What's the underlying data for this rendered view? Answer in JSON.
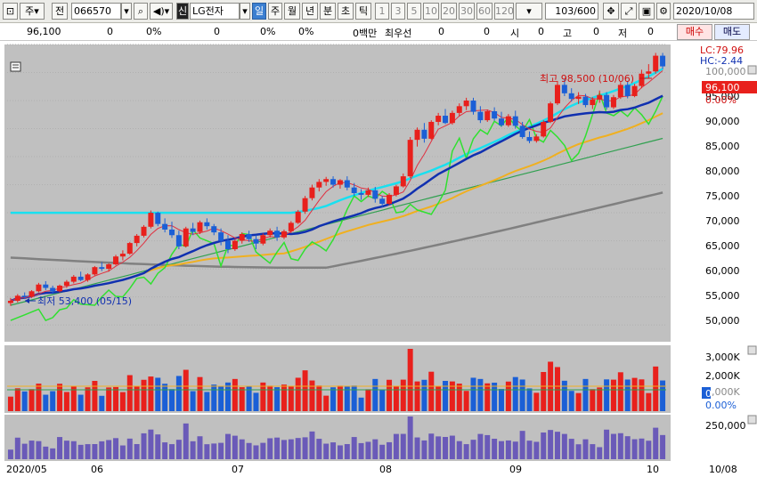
{
  "toolbar": {
    "period_label": "주",
    "prev_label": "전",
    "stock_code": "066570",
    "type_badge": "신",
    "stock_name": "LG전자",
    "timeframes": [
      "일",
      "주",
      "월",
      "년",
      "분",
      "초",
      "틱"
    ],
    "active_timeframe": "일",
    "intervals": [
      "1",
      "3",
      "5",
      "10",
      "20",
      "30",
      "60",
      "120"
    ],
    "count_display": "103/600",
    "date_value": "2020/10/08"
  },
  "info": {
    "price": "96,100",
    "change": "0",
    "change_pct": "0%",
    "volume": "0",
    "volume_pct": "0%",
    "pct3": "0%",
    "unit_label": "0백만",
    "best_label": "최우선",
    "v1": "0",
    "v2": "0",
    "open_label": "시",
    "open_val": "0",
    "high_label": "고",
    "high_val": "0",
    "low_label": "저",
    "low_val": "0",
    "buy_label": "매수",
    "sell_label": "매도"
  },
  "price_panel": {
    "lc_label": "LC:79.96",
    "hc_label": "HC:-2.44",
    "current_price_badge": "96,100",
    "current_pct": "0.00%",
    "high_annotation": "최고 98,500 (10/06)",
    "low_annotation": "최저 53,400 (05/15)",
    "y_ticks": [
      "100,000",
      "95,000",
      "90,000",
      "85,000",
      "80,000",
      "75,000",
      "70,000",
      "65,000",
      "60,000",
      "55,000",
      "50,000"
    ]
  },
  "volume_panel": {
    "y_ticks": [
      "3,000K",
      "2,000K",
      "1,000K",
      "0",
      "0.00%"
    ]
  },
  "trade_panel": {
    "y_ticks": [
      "250,000"
    ]
  },
  "x_axis": {
    "labels": [
      "2020/05",
      "06",
      "07",
      "08",
      "09",
      "10",
      "10/08"
    ]
  },
  "colors": {
    "up": "#e8201c",
    "down": "#1b5fd6",
    "ma5": "#e03040",
    "ma20": "#1030b0",
    "ma60": "#f0b020",
    "envelope": "#18e0f0",
    "ma120": "#30a050",
    "ma240": "#808080",
    "lagspan": "#30e030"
  },
  "chart_data": {
    "type": "candlestick",
    "ylim": [
      47000,
      100000
    ],
    "candles": [
      [
        53900,
        54800,
        53400,
        54300
      ],
      [
        54300,
        55500,
        54000,
        55200
      ],
      [
        55200,
        55800,
        54600,
        55000
      ],
      [
        55000,
        56200,
        54800,
        56000
      ],
      [
        56000,
        57500,
        55800,
        57200
      ],
      [
        57200,
        57800,
        56200,
        56600
      ],
      [
        56600,
        57000,
        55500,
        56000
      ],
      [
        56000,
        57200,
        55800,
        57000
      ],
      [
        57000,
        58000,
        56600,
        57700
      ],
      [
        57700,
        58900,
        57400,
        58600
      ],
      [
        58600,
        59500,
        57800,
        58000
      ],
      [
        58000,
        59200,
        57700,
        59000
      ],
      [
        59000,
        60500,
        58800,
        60300
      ],
      [
        60300,
        61200,
        59600,
        60000
      ],
      [
        60000,
        61000,
        59500,
        60800
      ],
      [
        60800,
        62500,
        60600,
        62200
      ],
      [
        62200,
        63300,
        61500,
        62700
      ],
      [
        62700,
        64800,
        62500,
        64600
      ],
      [
        64600,
        66200,
        64000,
        65900
      ],
      [
        65900,
        67800,
        65600,
        67500
      ],
      [
        67500,
        70400,
        67200,
        70000
      ],
      [
        70000,
        70200,
        67600,
        68000
      ],
      [
        68000,
        69000,
        66500,
        67000
      ],
      [
        67000,
        68400,
        65500,
        66000
      ],
      [
        66000,
        66800,
        63500,
        64000
      ],
      [
        64000,
        67500,
        63800,
        67200
      ],
      [
        67200,
        68200,
        66000,
        66600
      ],
      [
        66600,
        68600,
        66200,
        68300
      ],
      [
        68300,
        69000,
        67000,
        67600
      ],
      [
        67600,
        68000,
        66000,
        66500
      ],
      [
        66500,
        67200,
        64200,
        65000
      ],
      [
        65000,
        66000,
        62800,
        63500
      ],
      [
        63500,
        65300,
        63200,
        65000
      ],
      [
        65000,
        66500,
        64500,
        66200
      ],
      [
        66200,
        66800,
        64800,
        65300
      ],
      [
        65300,
        66000,
        63500,
        64500
      ],
      [
        64500,
        66300,
        64200,
        66000
      ],
      [
        66000,
        67200,
        65600,
        66800
      ],
      [
        66800,
        67500,
        65000,
        65600
      ],
      [
        65600,
        67000,
        65300,
        66700
      ],
      [
        66700,
        68500,
        66400,
        68200
      ],
      [
        68200,
        70500,
        68000,
        70200
      ],
      [
        70200,
        73000,
        69800,
        72600
      ],
      [
        72600,
        75000,
        72200,
        74500
      ],
      [
        74500,
        76000,
        73800,
        75500
      ],
      [
        75500,
        76400,
        74800,
        76000
      ],
      [
        76000,
        76500,
        74500,
        75000
      ],
      [
        75000,
        76000,
        74300,
        75800
      ],
      [
        75800,
        76500,
        74000,
        74500
      ],
      [
        74500,
        75300,
        73000,
        73500
      ],
      [
        73500,
        74200,
        72300,
        73200
      ],
      [
        73200,
        74500,
        72800,
        74000
      ],
      [
        74000,
        74600,
        71800,
        72500
      ],
      [
        72500,
        73000,
        71000,
        71600
      ],
      [
        71600,
        73500,
        71300,
        73200
      ],
      [
        73200,
        75000,
        72900,
        74700
      ],
      [
        74700,
        77000,
        74500,
        76500
      ],
      [
        76500,
        83500,
        76200,
        83000
      ],
      [
        83000,
        85200,
        81800,
        84800
      ],
      [
        84800,
        86000,
        82500,
        83200
      ],
      [
        83200,
        86500,
        83000,
        86200
      ],
      [
        86200,
        87800,
        85600,
        87300
      ],
      [
        87300,
        88500,
        85800,
        86000
      ],
      [
        86000,
        88200,
        85700,
        87800
      ],
      [
        87800,
        89500,
        87200,
        89000
      ],
      [
        89000,
        90500,
        88300,
        90000
      ],
      [
        90000,
        90500,
        87500,
        88000
      ],
      [
        88000,
        89000,
        86000,
        86500
      ],
      [
        86500,
        88400,
        86200,
        88100
      ],
      [
        88100,
        88800,
        86400,
        86800
      ],
      [
        86800,
        88000,
        85300,
        85600
      ],
      [
        85600,
        87600,
        85300,
        87200
      ],
      [
        87200,
        88200,
        85000,
        85500
      ],
      [
        85500,
        86200,
        83200,
        83500
      ],
      [
        83500,
        84500,
        82400,
        82800
      ],
      [
        82800,
        84000,
        82500,
        83600
      ],
      [
        83600,
        86500,
        83400,
        86200
      ],
      [
        86200,
        89800,
        86000,
        89500
      ],
      [
        89500,
        93500,
        89200,
        92800
      ],
      [
        92800,
        93800,
        90800,
        91300
      ],
      [
        91300,
        92200,
        89800,
        90300
      ],
      [
        90300,
        91500,
        89400,
        90700
      ],
      [
        90700,
        91200,
        88800,
        89200
      ],
      [
        89200,
        90600,
        88500,
        90200
      ],
      [
        90200,
        91800,
        89600,
        91000
      ],
      [
        91000,
        91500,
        88400,
        88800
      ],
      [
        88800,
        91000,
        88500,
        90600
      ],
      [
        90600,
        93300,
        90300,
        92800
      ],
      [
        92800,
        93500,
        90400,
        90800
      ],
      [
        90800,
        93000,
        90600,
        92600
      ],
      [
        92600,
        95500,
        92200,
        94800
      ],
      [
        94800,
        96500,
        94000,
        95200
      ],
      [
        95200,
        98500,
        94800,
        98000
      ],
      [
        98000,
        98500,
        95600,
        96100
      ]
    ]
  }
}
